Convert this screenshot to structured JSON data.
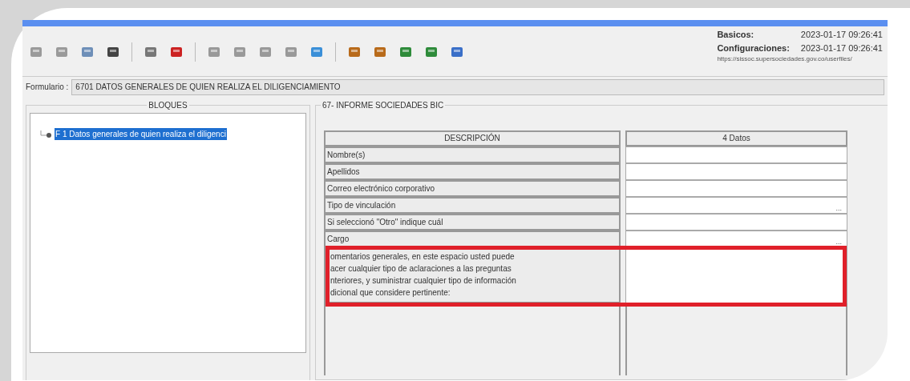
{
  "status": {
    "basicos_label": "Basicos:",
    "basicos_time": "2023-01-17 09:26:41",
    "config_label": "Configuraciones:",
    "config_time": "2023-01-17 09:26:41",
    "url": "https://sissoc.supersociedades.gov.co/userfiles/"
  },
  "formulario": {
    "label": "Formulario :",
    "value": "6701 DATOS GENERALES DE QUIEN REALIZA EL DILIGENCIAMIENTO"
  },
  "bloques": {
    "title": "BLOQUES",
    "items": [
      {
        "label": "F 1 Datos generales de quien realiza el diligenci",
        "selected": true
      }
    ]
  },
  "informe": {
    "title": "67- INFORME SOCIEDADES BIC",
    "columns": [
      "DESCRIPCIÓN",
      "4 Datos"
    ],
    "rows": [
      {
        "label": "Nombre(s)",
        "kind": "text"
      },
      {
        "label": "Apellidos",
        "kind": "text"
      },
      {
        "label": "Correo electrónico corporativo",
        "kind": "text"
      },
      {
        "label": "Tipo de vinculación",
        "kind": "picker",
        "button": "..."
      },
      {
        "label": "Si seleccionó \"Otro\" indique cuál",
        "kind": "text"
      },
      {
        "label": "Cargo",
        "kind": "picker",
        "button": "..."
      },
      {
        "label": "omentarios generales, en este espacio usted puede\nacer cualquier tipo de aclaraciones a las preguntas\nnteriores, y suministrar cualquier tipo de información\ndicional que considere pertinente:",
        "kind": "textarea",
        "highlighted": true
      }
    ]
  }
}
